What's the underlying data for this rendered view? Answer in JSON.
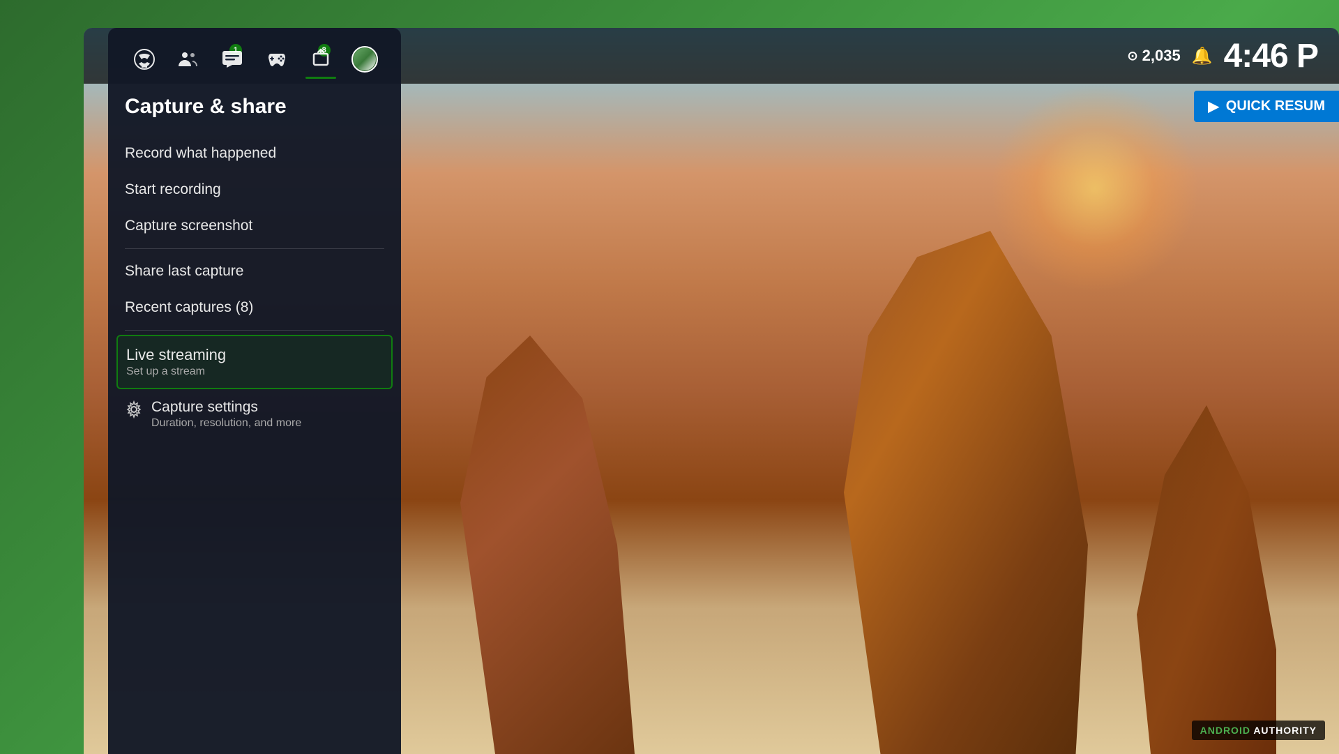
{
  "background": {
    "color": "#2d6b2d"
  },
  "top_bar": {
    "gamerscore_icon": "⊙",
    "gamerscore": "2,035",
    "bell_icon": "🔔",
    "time": "4:46 P"
  },
  "quick_resume": {
    "icon": "▶",
    "label": "QUICK RESUM"
  },
  "nav": {
    "items": [
      {
        "id": "xbox",
        "icon": "xbox",
        "badge": null,
        "active": false
      },
      {
        "id": "people",
        "icon": "people",
        "badge": null,
        "active": false
      },
      {
        "id": "chat",
        "icon": "chat",
        "badge": "1",
        "active": false
      },
      {
        "id": "controller",
        "icon": "controller",
        "badge": null,
        "active": false
      },
      {
        "id": "share",
        "icon": "share",
        "badge": "8",
        "active": true
      },
      {
        "id": "avatar",
        "icon": "avatar",
        "badge": null,
        "active": false
      }
    ]
  },
  "panel": {
    "title": "Capture & share",
    "menu_items": [
      {
        "id": "record-what-happened",
        "label": "Record what happened",
        "sub": null,
        "divider_after": false
      },
      {
        "id": "start-recording",
        "label": "Start recording",
        "sub": null,
        "divider_after": false
      },
      {
        "id": "capture-screenshot",
        "label": "Capture screenshot",
        "sub": null,
        "divider_after": true
      },
      {
        "id": "share-last-capture",
        "label": "Share last capture",
        "sub": null,
        "divider_after": false
      },
      {
        "id": "recent-captures",
        "label": "Recent captures (8)",
        "sub": null,
        "divider_after": true
      },
      {
        "id": "live-streaming",
        "label": "Live streaming",
        "sub": "Set up a stream",
        "highlighted": true,
        "divider_after": false
      },
      {
        "id": "capture-settings",
        "label": "Capture settings",
        "sub": "Duration, resolution, and more",
        "settings": true,
        "divider_after": false
      }
    ]
  },
  "watermark": {
    "brand": "ANDROID",
    "suffix": " AUTHORITY"
  }
}
